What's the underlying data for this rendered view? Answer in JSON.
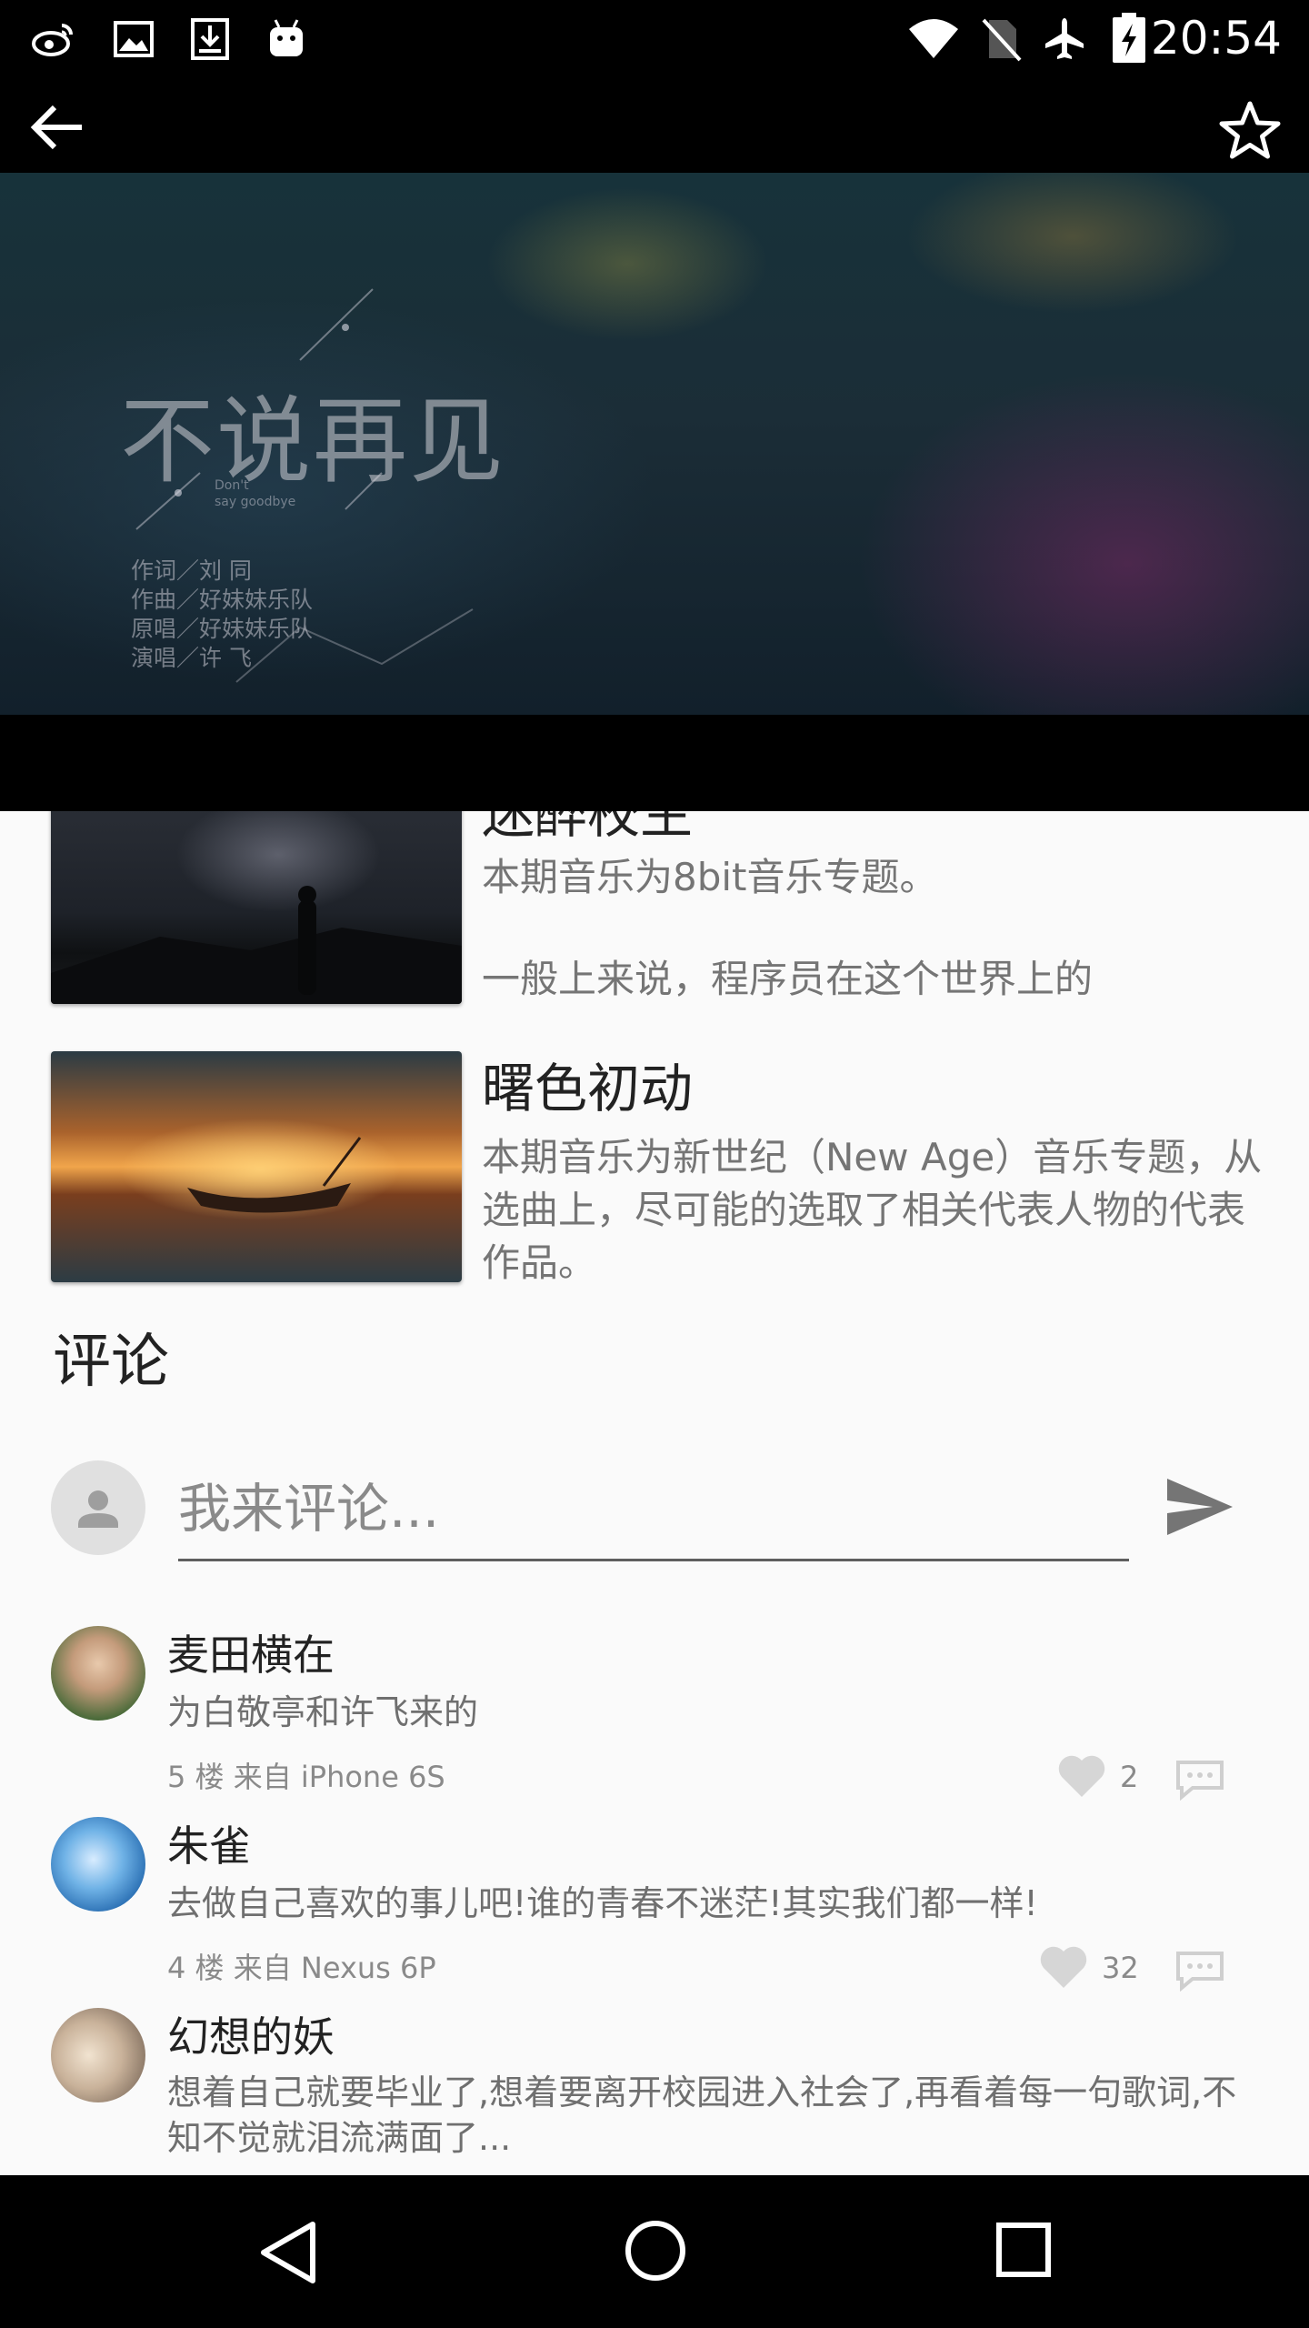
{
  "status_bar": {
    "time": "20:54",
    "icons": [
      "weibo-icon",
      "image-icon",
      "download-icon",
      "android-icon",
      "wifi-icon",
      "no-sim-icon",
      "airplane-icon",
      "battery-charging-icon"
    ]
  },
  "toolbar": {
    "back_icon": "arrow-left-icon",
    "favorite_icon": "star-outline-icon"
  },
  "hero": {
    "title": "不说再见",
    "subtitle_line1": "Don't",
    "subtitle_line2": "say goodbye",
    "credits": [
      "作词／刘 同",
      "作曲／好妹妹乐队",
      "原唱／好妹妹乐队",
      "演唱／许 飞"
    ]
  },
  "music_list": [
    {
      "title": "迷醉校生",
      "desc_line1": "本期音乐为8bit音乐专题。",
      "desc_line2": "一般上来说，程序员在这个世界上的"
    },
    {
      "title": "曙色初动",
      "desc": "本期音乐为新世纪（New Age）音乐专题，从选曲上，尽可能的选取了相关代表人物的代表作品。"
    }
  ],
  "comments_section": {
    "title": "评论",
    "input_placeholder": "我来评论...",
    "send_icon": "send-icon"
  },
  "comments": [
    {
      "name": "麦田横在",
      "text": "为白敬亭和许飞来的",
      "meta": "5 楼  来自 iPhone 6S",
      "likes": "2"
    },
    {
      "name": "朱雀",
      "text": "去做自己喜欢的事儿吧!谁的青春不迷茫!其实我们都一样!",
      "meta": "4 楼  来自 Nexus 6P",
      "likes": "32"
    },
    {
      "name": "幻想的妖",
      "text": "想着自己就要毕业了,想着要离开校园进入社会了,再看着每一句歌词,不知不觉就泪流满面了..."
    }
  ],
  "nav_bar": {
    "back_icon": "triangle-back-icon",
    "home_icon": "circle-home-icon",
    "recents_icon": "square-recents-icon"
  },
  "colors": {
    "status_bg": "#000000",
    "page_bg": "#fafafa",
    "text_primary": "#222222",
    "text_secondary": "#757575"
  }
}
